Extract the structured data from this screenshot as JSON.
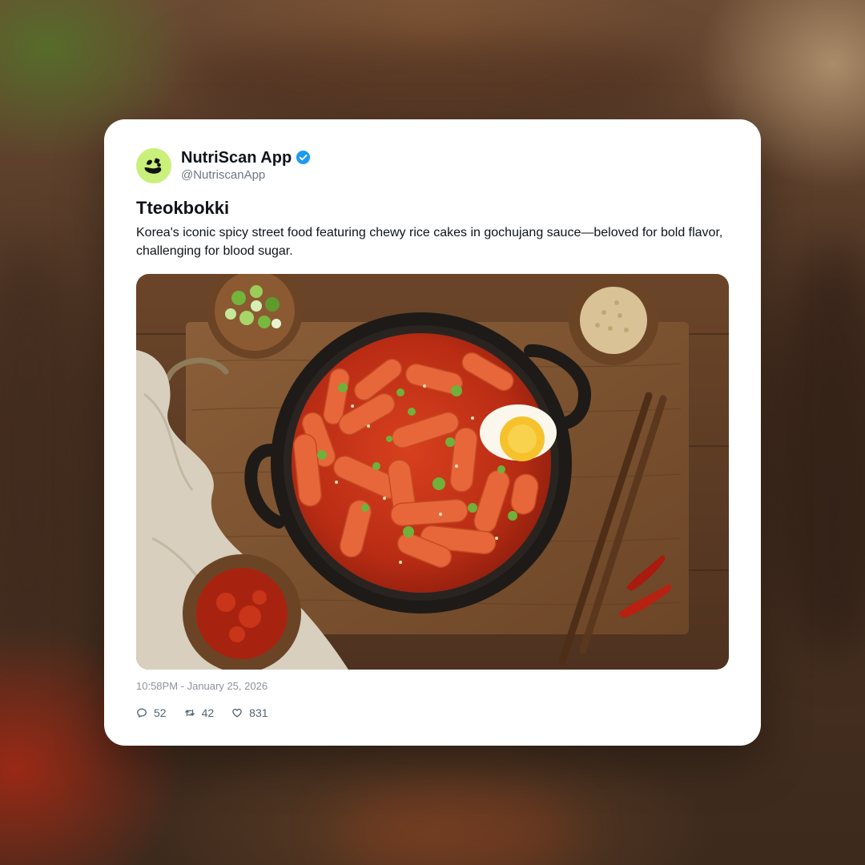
{
  "post": {
    "display_name": "NutriScan App",
    "handle": "@NutriscanApp",
    "verified": true,
    "avatar_icon": "leaf-logo-icon",
    "title": "Tteokbokki",
    "body": "Korea's iconic spicy street food featuring chewy rice cakes in gochujang sauce—beloved for bold flavor, challenging for blood sugar.",
    "image_icon": "tteokbokki-photo",
    "timestamp": "10:58PM - January 25, 2026",
    "stats": {
      "replies": "52",
      "reposts": "42",
      "likes": "831"
    }
  },
  "colors": {
    "avatar_bg": "#c9f07a",
    "verified_blue": "#1d9bf0",
    "text_primary": "#0f1419",
    "text_secondary": "#6e7782"
  },
  "icons": {
    "reply": "reply-icon",
    "repost": "repost-icon",
    "like": "heart-icon",
    "verified": "verified-badge-icon"
  }
}
